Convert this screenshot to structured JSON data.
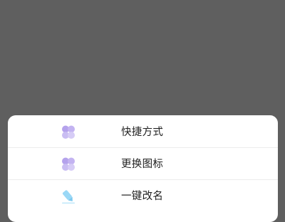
{
  "menu": {
    "items": [
      {
        "label": "快捷方式",
        "icon": "clover-icon"
      },
      {
        "label": "更换图标",
        "icon": "clover-icon"
      },
      {
        "label": "一键改名",
        "icon": "pencil-icon"
      }
    ]
  },
  "colors": {
    "overlay": "#5f5f5f",
    "sheet": "#ffffff",
    "clover_top": "#b9a6ee",
    "clover_bottom": "#c9bdf2",
    "pencil": "#8fd3f5"
  }
}
